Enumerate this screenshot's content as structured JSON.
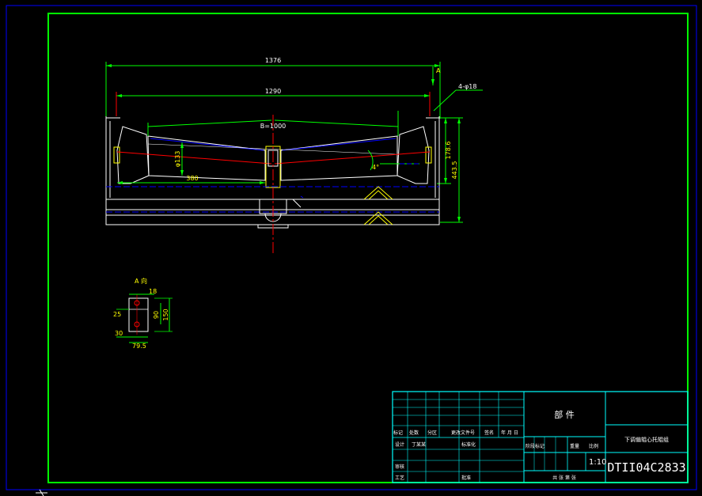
{
  "colors": {
    "background": "#000000",
    "outer_border": "#0000ff",
    "frame": "#00ff00",
    "title_block": "#00ffff",
    "dimension": "#00ff00",
    "dimension_text": "#ffff00",
    "center_line": "#ff0000",
    "hidden_line": "#0000ff",
    "outline": "#ffffff"
  },
  "dimensions": {
    "overall_width": "1376",
    "bolt_spacing": "1290",
    "belt_width": "B=1000",
    "roller_length": "380",
    "roller_dia": "φ133",
    "height_upper": "178.6",
    "height_total": "443.5",
    "hole": "4-φ18",
    "tilt_angle": "4°",
    "section_marker": "A"
  },
  "detail_a": {
    "title": "A 向",
    "dim_top": "18",
    "dim_left": "25",
    "dim_bottom_left": "30",
    "dim_bottom": "79.5",
    "dim_inner": "90",
    "dim_outer": "150"
  },
  "title_block": {
    "part_label": "部 件",
    "product_name": "下调偏辊心托辊组",
    "drawing_number": "DTII04C2833",
    "scale": "1:10",
    "rev_headers": [
      "标记",
      "处数",
      "分区",
      "更改文件号",
      "签名",
      "年 月 日"
    ],
    "design_label": "设计",
    "designer": "丁某某",
    "standardize_label": "标准化",
    "review_label": "审核",
    "process_label": "工艺",
    "approve_label": "批准",
    "stage_headers": [
      "阶段标记",
      "重量",
      "比例"
    ],
    "sheet_label": "共 张 第 张"
  }
}
